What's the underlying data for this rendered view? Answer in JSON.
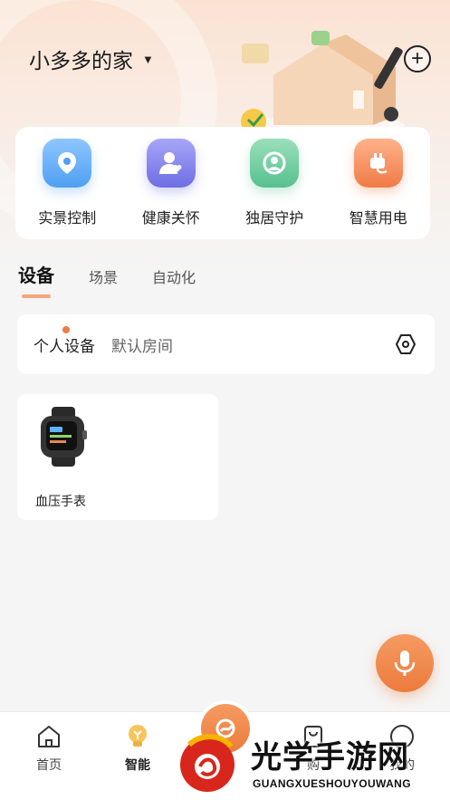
{
  "header": {
    "home_name": "小多多的家",
    "home_dropdown_icon": "caret-down-icon",
    "add_icon": "plus-circle-icon"
  },
  "quick_actions": [
    {
      "label": "实景控制",
      "icon": "location-pin-icon",
      "color": "#4f9ff2"
    },
    {
      "label": "健康关怀",
      "icon": "person-heart-icon",
      "color": "#6e6de4"
    },
    {
      "label": "独居守护",
      "icon": "shield-person-icon",
      "color": "#56c08e"
    },
    {
      "label": "智慧用电",
      "icon": "power-plug-icon",
      "color": "#f07a46"
    }
  ],
  "tabs": [
    {
      "label": "设备",
      "active": true
    },
    {
      "label": "场景",
      "active": false
    },
    {
      "label": "自动化",
      "active": false
    }
  ],
  "rooms": {
    "items": [
      {
        "label": "个人设备",
        "active": true,
        "has_dot": true
      },
      {
        "label": "默认房间",
        "active": false
      }
    ],
    "settings_icon": "hexagon-settings-icon"
  },
  "devices": [
    {
      "name": "血压手表",
      "icon": "smartwatch-icon"
    }
  ],
  "voice_button": {
    "icon": "microphone-icon"
  },
  "bottom_nav": [
    {
      "label": "首页",
      "icon": "home-icon",
      "active": false
    },
    {
      "label": "智能",
      "icon": "lightbulb-icon",
      "active": true
    },
    {
      "label": "",
      "icon": "center-logo-icon",
      "active": false
    },
    {
      "label": "购",
      "icon": "shopping-bag-icon",
      "active": false
    },
    {
      "label": "我的",
      "icon": "user-circle-icon",
      "active": false
    }
  ],
  "watermark": {
    "title": "光学手游网",
    "subtitle": "GUANGXUESHOUYOUWANG"
  },
  "colors": {
    "accent": "#f07a46",
    "tab_underline": "#f4a77b",
    "background": "#f5f5f5"
  }
}
